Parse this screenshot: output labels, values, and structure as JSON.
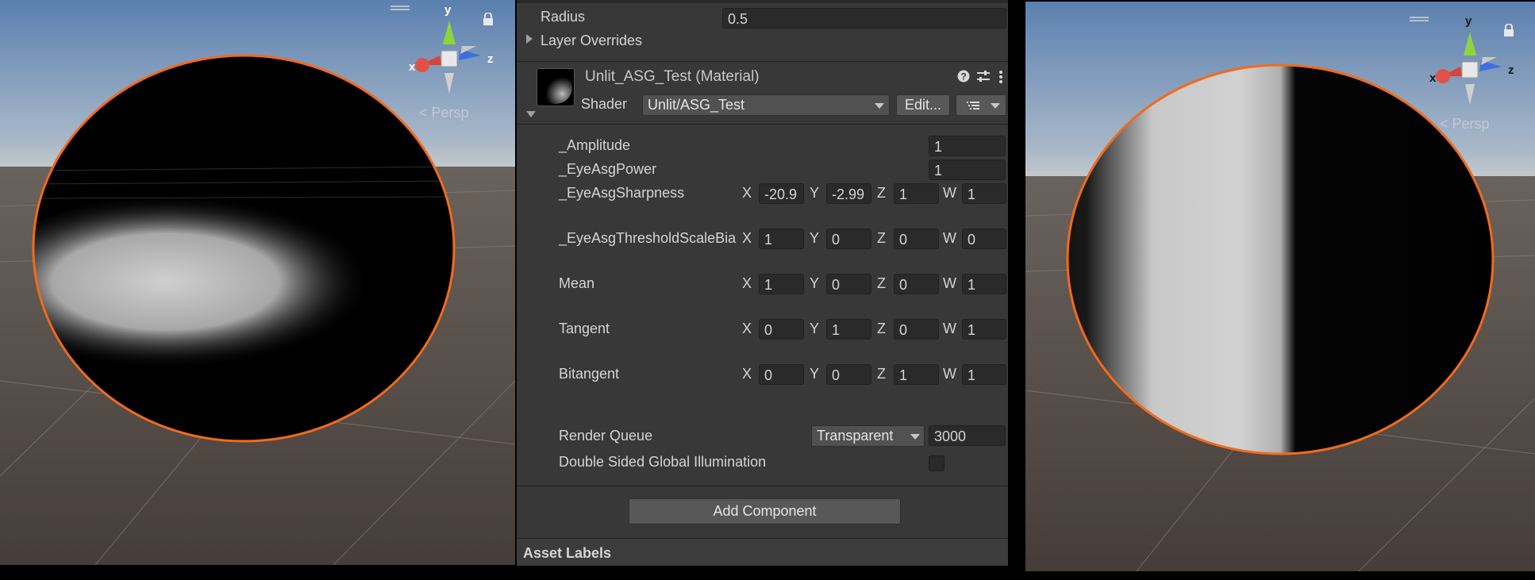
{
  "colors": {
    "sky": "#5f87b6",
    "horizon": "#b9c4cf",
    "ground": "#4e4540",
    "selection_outline": "#f26a1b",
    "inspector_bg": "#383838",
    "field_bg": "#2a2a2a",
    "text": "#d4d4d4"
  },
  "left_viewport": {
    "persp_label": "< Persp",
    "gizmo": {
      "x": "x",
      "y": "y",
      "z": "z"
    },
    "icons": [
      "hamburger-icon",
      "lock-icon"
    ]
  },
  "right_viewport": {
    "persp_label": "< Persp",
    "gizmo": {
      "x": "x",
      "y": "y",
      "z": "z"
    },
    "icons": [
      "hamburger-icon",
      "lock-icon"
    ]
  },
  "inspector": {
    "radius_label": "Radius",
    "radius_value": "0.5",
    "layer_overrides_label": "Layer Overrides",
    "material": {
      "title": "Unlit_ASG_Test (Material)",
      "shader_label": "Shader",
      "shader_value": "Unlit/ASG_Test",
      "edit_label": "Edit...",
      "header_icons": [
        "help-icon",
        "preset-icon",
        "kebab-menu-icon"
      ]
    },
    "properties": {
      "amplitude": {
        "label": "_Amplitude",
        "value": "1"
      },
      "eye_asg_power": {
        "label": "_EyeAsgPower",
        "value": "1"
      },
      "eye_asg_sharpness": {
        "label": "_EyeAsgSharpness",
        "x": "-20.9",
        "y": "-2.99",
        "z": "1",
        "w": "1"
      },
      "eye_asg_threshold": {
        "label": "_EyeAsgThresholdScaleBia",
        "x": "1",
        "y": "0",
        "z": "0",
        "w": "0"
      },
      "mean": {
        "label": "Mean",
        "x": "1",
        "y": "0",
        "z": "0",
        "w": "1"
      },
      "tangent": {
        "label": "Tangent",
        "x": "0",
        "y": "1",
        "z": "0",
        "w": "1"
      },
      "bitangent": {
        "label": "Bitangent",
        "x": "0",
        "y": "0",
        "z": "1",
        "w": "1"
      }
    },
    "axis_labels": {
      "x": "X",
      "y": "Y",
      "z": "Z",
      "w": "W"
    },
    "render_queue": {
      "label": "Render Queue",
      "dropdown": "Transparent",
      "value": "3000"
    },
    "double_sided_gi": {
      "label": "Double Sided Global Illumination",
      "checked": false
    },
    "add_component_label": "Add Component",
    "asset_labels_title": "Asset Labels"
  }
}
